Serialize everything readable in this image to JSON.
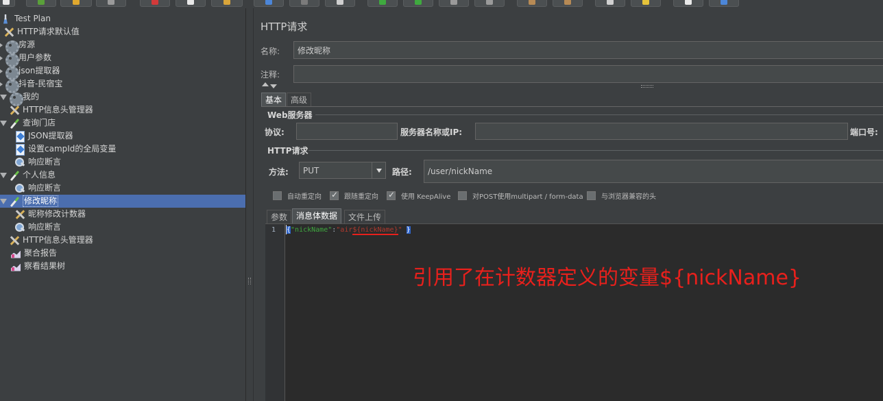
{
  "tree": {
    "items": [
      {
        "label": "Test Plan",
        "icon": "flask-icon",
        "expander": "none"
      },
      {
        "label": "HTTP请求默认值",
        "icon": "tools-icon",
        "expander": "none"
      },
      {
        "label": "房源",
        "icon": "gear-icon",
        "expander": "collapsed"
      },
      {
        "label": "用户参数",
        "icon": "gear-icon",
        "expander": "collapsed"
      },
      {
        "label": "json提取器",
        "icon": "gear-icon",
        "expander": "collapsed"
      },
      {
        "label": "抖音-民宿宝",
        "icon": "gear-icon",
        "expander": "collapsed"
      },
      {
        "label": "我的",
        "icon": "gear-icon",
        "expander": "expanded"
      },
      {
        "label": "HTTP信息头管理器",
        "icon": "tools-icon",
        "expander": "none"
      },
      {
        "label": "查询门店",
        "icon": "pipette-icon",
        "expander": "expanded"
      },
      {
        "label": "JSON提取器",
        "icon": "doc-icon",
        "expander": "none"
      },
      {
        "label": "设置campId的全局变量",
        "icon": "doc-icon",
        "expander": "none"
      },
      {
        "label": "响应断言",
        "icon": "magnifier-icon",
        "expander": "none"
      },
      {
        "label": "个人信息",
        "icon": "pipette-icon",
        "expander": "expanded"
      },
      {
        "label": "响应断言",
        "icon": "magnifier-icon",
        "expander": "none"
      },
      {
        "label": "修改昵称",
        "icon": "pipette-icon",
        "expander": "expanded",
        "selected": true
      },
      {
        "label": "昵称修改计数器",
        "icon": "tools-icon",
        "expander": "none"
      },
      {
        "label": "响应断言",
        "icon": "magnifier-icon",
        "expander": "none"
      },
      {
        "label": "HTTP信息头管理器",
        "icon": "tools-icon",
        "expander": "none"
      },
      {
        "label": "聚合报告",
        "icon": "chart-icon",
        "expander": "none"
      },
      {
        "label": "察看结果树",
        "icon": "chart-icon",
        "expander": "none"
      }
    ]
  },
  "panel": {
    "title": "HTTP请求",
    "name_label": "名称:",
    "name_value": "修改昵称",
    "comment_label": "注释:",
    "comment_value": "",
    "tabs": [
      "基本",
      "高级"
    ],
    "web_server": {
      "group_title": "Web服务器",
      "protocol_label": "协议:",
      "protocol_value": "",
      "server_label": "服务器名称或IP:",
      "server_value": "",
      "port_label": "端口号:"
    },
    "http_request": {
      "group_title": "HTTP请求",
      "method_label": "方法:",
      "method_value": "PUT",
      "path_label": "路径:",
      "path_value": "/user/nickName"
    },
    "checkboxes": [
      {
        "label": "自动重定向",
        "checked": false
      },
      {
        "label": "跟随重定向",
        "checked": true
      },
      {
        "label": "使用 KeepAlive",
        "checked": true
      },
      {
        "label": "对POST使用multipart / form-data",
        "checked": false
      },
      {
        "label": "与浏览器兼容的头",
        "checked": false
      }
    ],
    "body_tabs": [
      "参数",
      "消息体数据",
      "文件上传"
    ],
    "editor": {
      "line_number": "1",
      "brace_open": "{",
      "key": "\"nickName\"",
      "colon": ":",
      "value_prefix": "\"air",
      "value_var": "${nickName}",
      "value_suffix": "\"",
      "brace_close": "}"
    },
    "annotation": "引用了在计数器定义的变量${nickName}"
  },
  "colors": {
    "background": "#3c3f41",
    "selection": "#4b6eaf",
    "annotation_red": "#e8201c",
    "json_key_green": "#3fa83f"
  }
}
